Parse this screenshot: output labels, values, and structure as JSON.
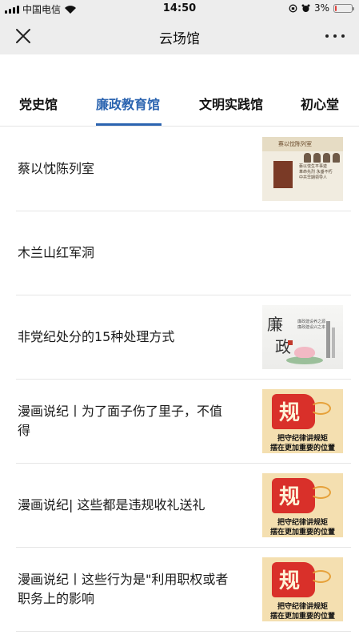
{
  "status_bar": {
    "carrier": "中国电信",
    "time": "14:50",
    "battery": "3%",
    "battery_level": 0.03
  },
  "nav": {
    "title": "云场馆",
    "close_icon": "close-icon",
    "more_icon": "more-icon"
  },
  "tabs": [
    {
      "label": "党史馆",
      "active": false
    },
    {
      "label": "廉政教育馆",
      "active": true
    },
    {
      "label": "文明实践馆",
      "active": false
    },
    {
      "label": "初心堂",
      "active": false
    }
  ],
  "accent_color": "#2b64b0",
  "items": [
    {
      "title": "蔡以忱陈列室",
      "thumb": "poster",
      "thumb_banner": "蔡以忱陈列室",
      "thumb_text": "蔡以忱生平事迹\n革命先烈 永垂不朽\n中共早期领导人"
    },
    {
      "title": "木兰山红军洞",
      "thumb": "none"
    },
    {
      "title": "非党纪处分的15种处理方式",
      "thumb": "lianzheng",
      "thumb_chars": [
        "廉",
        "政"
      ],
      "thumb_text": "廉政建设养之源\n廉政建设兴之本"
    },
    {
      "title": "漫画说纪丨为了面子伤了里子，不值得",
      "thumb": "gui",
      "thumb_char": "规",
      "thumb_lines": [
        "把守纪律讲规矩",
        "摆在更加重要的位置"
      ]
    },
    {
      "title": "漫画说纪| 这些都是违规收礼送礼",
      "thumb": "gui",
      "thumb_char": "规",
      "thumb_lines": [
        "把守纪律讲规矩",
        "摆在更加重要的位置"
      ]
    },
    {
      "title": "漫画说纪丨这些行为是\"利用职权或者职务上的影响",
      "thumb": "gui",
      "thumb_char": "规",
      "thumb_lines": [
        "把守纪律讲规矩",
        "摆在更加重要的位置"
      ]
    }
  ]
}
